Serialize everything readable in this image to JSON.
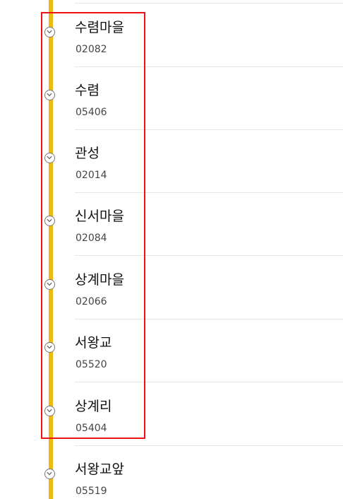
{
  "colors": {
    "route_line": "#f0b90f",
    "highlight_border": "#ee1111",
    "marker_border": "#777777",
    "divider": "#e6e6e6"
  },
  "marker_icon": "chevron-down-icon",
  "stops": [
    {
      "name": "수렴마을",
      "number": "02082"
    },
    {
      "name": "수렴",
      "number": "05406"
    },
    {
      "name": "관성",
      "number": "02014"
    },
    {
      "name": "신서마을",
      "number": "02084"
    },
    {
      "name": "상계마을",
      "number": "02066"
    },
    {
      "name": "서왕교",
      "number": "05520"
    },
    {
      "name": "상계리",
      "number": "05404"
    },
    {
      "name": "서왕교앞",
      "number": "05519"
    }
  ]
}
